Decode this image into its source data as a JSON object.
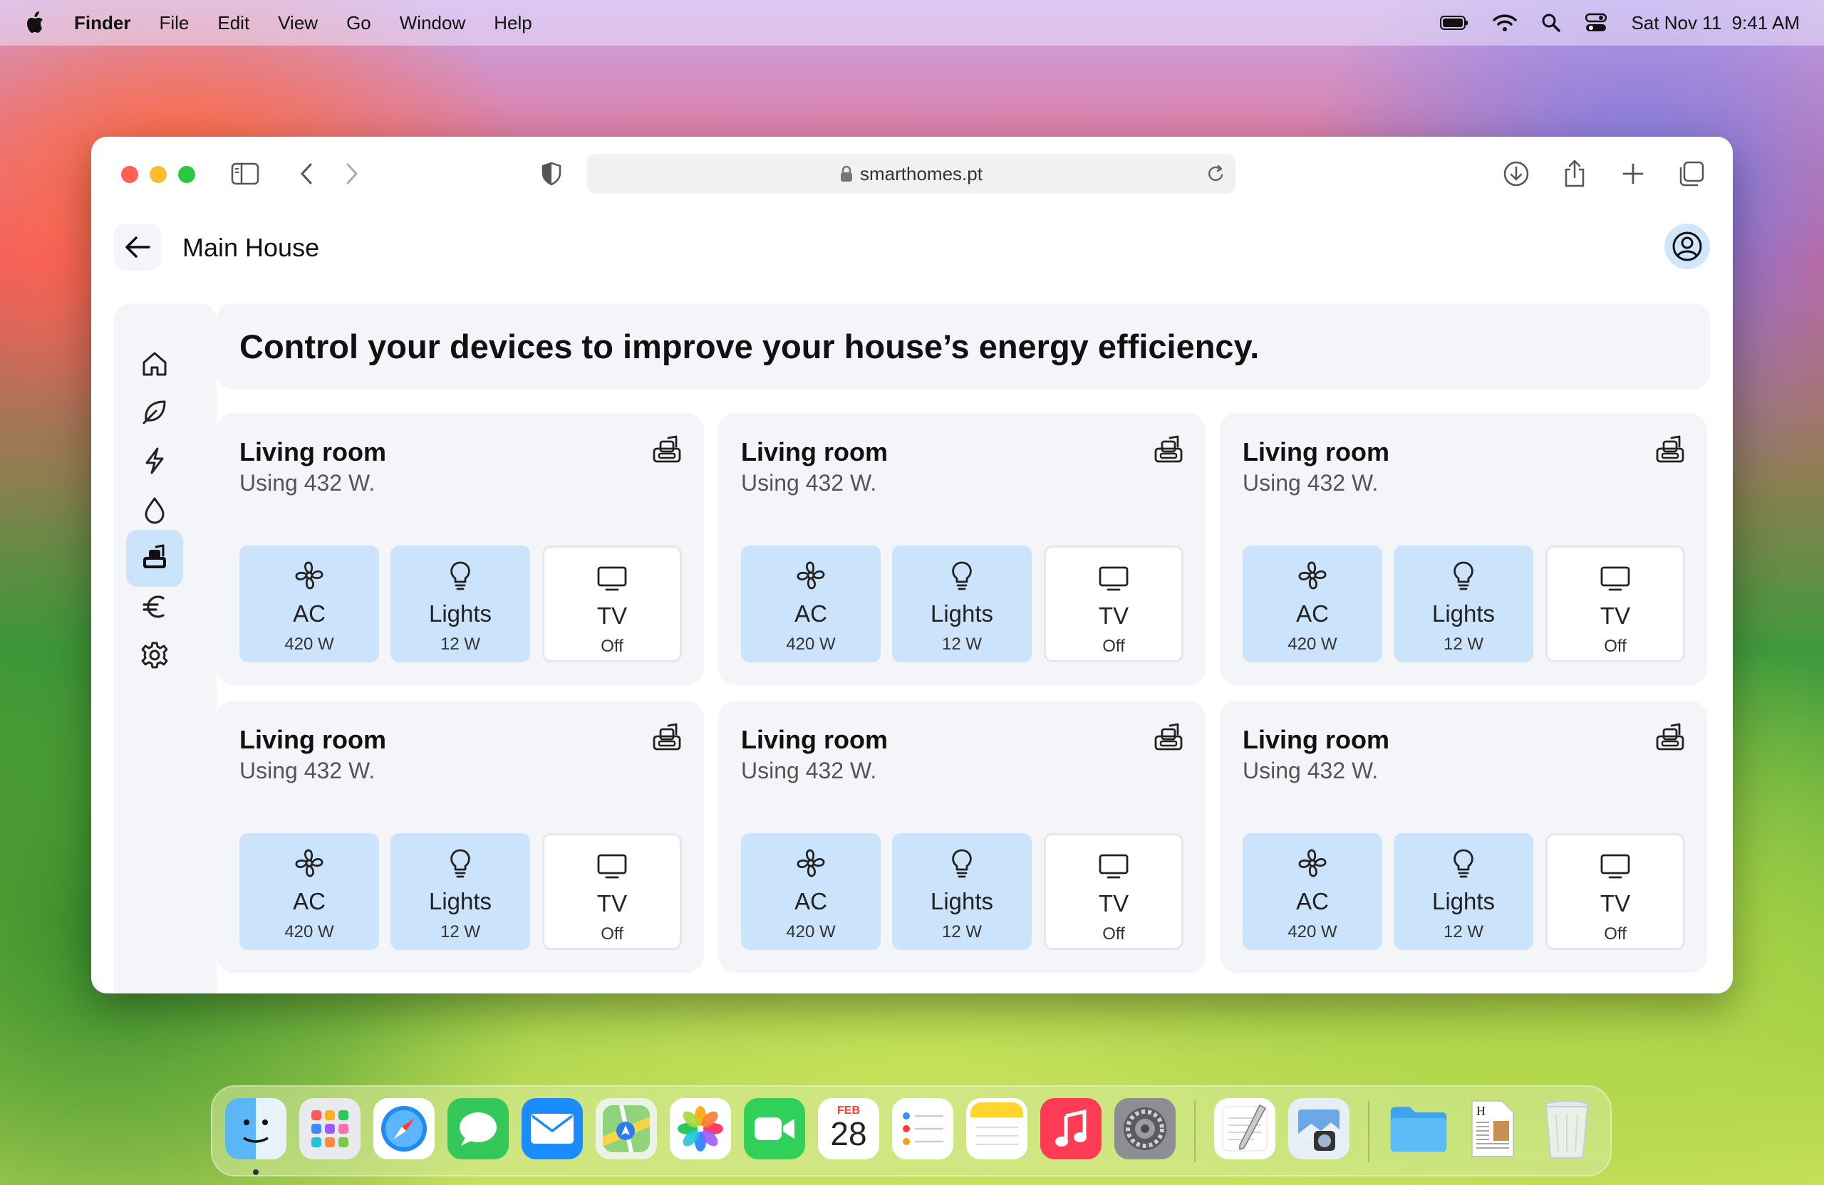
{
  "menubar": {
    "items": [
      "Finder",
      "File",
      "Edit",
      "View",
      "Go",
      "Window",
      "Help"
    ],
    "clock": "Sat Nov 11  9:41 AM"
  },
  "browser": {
    "url": "smarthomes.pt"
  },
  "app": {
    "page_title": "Main House",
    "banner": "Control your devices to improve your house’s energy efficiency.",
    "rooms": [
      {
        "title": "Living room",
        "usage": "Using 432 W.",
        "devices": [
          {
            "name": "AC",
            "value": "420 W",
            "on": true,
            "icon": "fan-icon"
          },
          {
            "name": "Lights",
            "value": "12 W",
            "on": true,
            "icon": "lightbulb-icon"
          },
          {
            "name": "TV",
            "value": "Off",
            "on": false,
            "icon": "tv-icon"
          }
        ]
      },
      {
        "title": "Living room",
        "usage": "Using 432 W.",
        "devices": [
          {
            "name": "AC",
            "value": "420 W",
            "on": true,
            "icon": "fan-icon"
          },
          {
            "name": "Lights",
            "value": "12 W",
            "on": true,
            "icon": "lightbulb-icon"
          },
          {
            "name": "TV",
            "value": "Off",
            "on": false,
            "icon": "tv-icon"
          }
        ]
      },
      {
        "title": "Living room",
        "usage": "Using 432 W.",
        "devices": [
          {
            "name": "AC",
            "value": "420 W",
            "on": true,
            "icon": "fan-icon"
          },
          {
            "name": "Lights",
            "value": "12 W",
            "on": true,
            "icon": "lightbulb-icon"
          },
          {
            "name": "TV",
            "value": "Off",
            "on": false,
            "icon": "tv-icon"
          }
        ]
      },
      {
        "title": "Living room",
        "usage": "Using 432 W.",
        "devices": [
          {
            "name": "AC",
            "value": "420 W",
            "on": true,
            "icon": "fan-icon"
          },
          {
            "name": "Lights",
            "value": "12 W",
            "on": true,
            "icon": "lightbulb-icon"
          },
          {
            "name": "TV",
            "value": "Off",
            "on": false,
            "icon": "tv-icon"
          }
        ]
      },
      {
        "title": "Living room",
        "usage": "Using 432 W.",
        "devices": [
          {
            "name": "AC",
            "value": "420 W",
            "on": true,
            "icon": "fan-icon"
          },
          {
            "name": "Lights",
            "value": "12 W",
            "on": true,
            "icon": "lightbulb-icon"
          },
          {
            "name": "TV",
            "value": "Off",
            "on": false,
            "icon": "tv-icon"
          }
        ]
      },
      {
        "title": "Living room",
        "usage": "Using 432 W.",
        "devices": [
          {
            "name": "AC",
            "value": "420 W",
            "on": true,
            "icon": "fan-icon"
          },
          {
            "name": "Lights",
            "value": "12 W",
            "on": true,
            "icon": "lightbulb-icon"
          },
          {
            "name": "TV",
            "value": "Off",
            "on": false,
            "icon": "tv-icon"
          }
        ]
      }
    ],
    "sidebar": [
      "home-icon",
      "leaf-icon",
      "lightning-icon",
      "water-drop-icon",
      "room-icon",
      "euro-icon",
      "gear-icon"
    ],
    "active_nav": "room-icon"
  },
  "calendar": {
    "month": "FEB",
    "day": "28"
  },
  "colors": {
    "device_on": "#cbe4fb",
    "card_bg": "#f4f5f9",
    "accent": "#cbe4fb"
  }
}
